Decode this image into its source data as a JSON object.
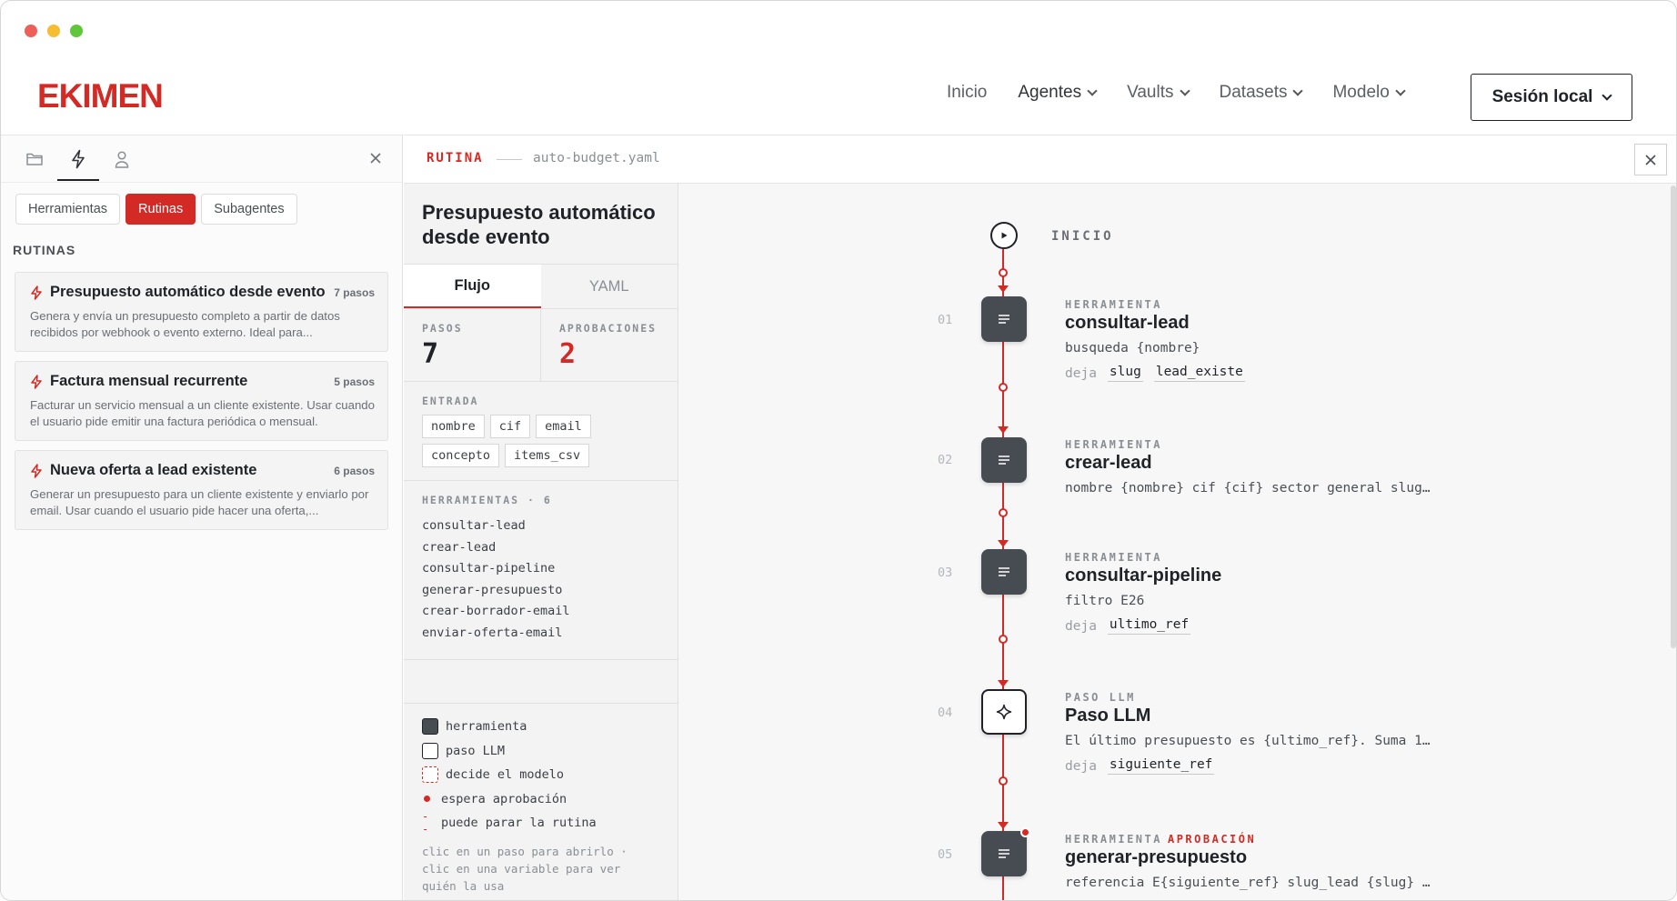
{
  "header": {
    "logo": "EKIMEN",
    "nav": [
      {
        "label": "Inicio",
        "dropdown": false
      },
      {
        "label": "Agentes",
        "dropdown": true
      },
      {
        "label": "Vaults",
        "dropdown": true
      },
      {
        "label": "Datasets",
        "dropdown": true
      },
      {
        "label": "Modelo",
        "dropdown": true
      }
    ],
    "session_button": "Sesión local"
  },
  "sidebar": {
    "icons": [
      "folder-icon",
      "bolt-icon",
      "user-icon"
    ],
    "tabs": [
      "Herramientas",
      "Rutinas",
      "Subagentes"
    ],
    "active_tab": "Rutinas",
    "heading": "RUTINAS",
    "routines": [
      {
        "title": "Presupuesto automático desde evento",
        "steps": "7 pasos",
        "desc": "Genera y envía un presupuesto completo a partir de datos recibidos por webhook o evento externo. Ideal para..."
      },
      {
        "title": "Factura mensual recurrente",
        "steps": "5 pasos",
        "desc": "Facturar un servicio mensual a un cliente existente. Usar cuando el usuario pide emitir una factura periódica o mensual."
      },
      {
        "title": "Nueva oferta a lead existente",
        "steps": "6 pasos",
        "desc": "Generar un presupuesto para un cliente existente y enviarlo por email. Usar cuando el usuario pide hacer una oferta,..."
      }
    ]
  },
  "routine_bar": {
    "label": "RUTINA",
    "file": "auto-budget.yaml"
  },
  "detail": {
    "title": "Presupuesto automático desde evento",
    "tabs": [
      "Flujo",
      "YAML"
    ],
    "active_tab": "Flujo",
    "stats": [
      {
        "label": "PASOS",
        "value": "7"
      },
      {
        "label": "APROBACIONES",
        "value": "2"
      }
    ],
    "input_label": "ENTRADA",
    "inputs": [
      "nombre",
      "cif",
      "email",
      "concepto",
      "items_csv"
    ],
    "tools_label": "HERRAMIENTAS · 6",
    "tools": [
      "consultar-lead",
      "crear-lead",
      "consultar-pipeline",
      "generar-presupuesto",
      "crear-borrador-email",
      "enviar-oferta-email"
    ],
    "legend": [
      {
        "label": "herramienta"
      },
      {
        "label": "paso LLM"
      },
      {
        "label": "decide el modelo"
      },
      {
        "label": "espera aprobación"
      },
      {
        "label": "puede parar la rutina"
      }
    ],
    "legend_hint": "clic en un paso para abrirlo · clic en una variable para ver quién la usa"
  },
  "flow": {
    "start_label": "INICIO",
    "steps": [
      {
        "num": "01",
        "type": "HERRAMIENTA",
        "approval": "",
        "name": "consultar-lead",
        "args": "busqueda {nombre}",
        "out_label": "deja",
        "outputs": [
          "slug",
          "lead_existe"
        ]
      },
      {
        "num": "02",
        "type": "HERRAMIENTA",
        "approval": "",
        "name": "crear-lead",
        "args": "nombre {nombre} cif {cif} sector general slug…",
        "out_label": "",
        "outputs": []
      },
      {
        "num": "03",
        "type": "HERRAMIENTA",
        "approval": "",
        "name": "consultar-pipeline",
        "args": "filtro E26",
        "out_label": "deja",
        "outputs": [
          "ultimo_ref"
        ]
      },
      {
        "num": "04",
        "type": "PASO LLM",
        "approval": "",
        "name": "Paso LLM",
        "args": "El último presupuesto es {ultimo_ref}. Suma 1…",
        "out_label": "deja",
        "outputs": [
          "siguiente_ref"
        ]
      },
      {
        "num": "05",
        "type": "HERRAMIENTA",
        "approval": "APROBACIÓN",
        "name": "generar-presupuesto",
        "args": "referencia E{siguiente_ref} slug_lead {slug} …",
        "out_label": "",
        "outputs": []
      }
    ]
  },
  "colors": {
    "accent": "#d42a25",
    "tool_node": "#474c52",
    "text": "#1f2328"
  }
}
